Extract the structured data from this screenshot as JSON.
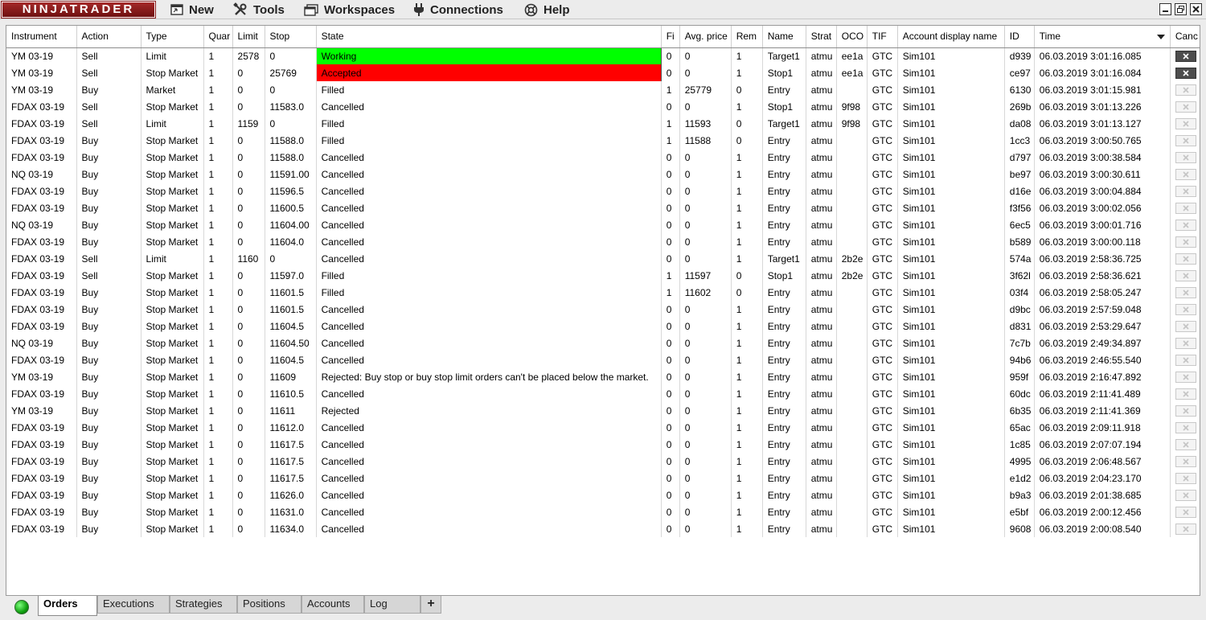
{
  "app": {
    "logo_text": "NINJATRADER"
  },
  "menu": [
    {
      "label": "New",
      "icon": "new-window-icon"
    },
    {
      "label": "Tools",
      "icon": "tools-icon"
    },
    {
      "label": "Workspaces",
      "icon": "workspaces-icon"
    },
    {
      "label": "Connections",
      "icon": "plug-icon"
    },
    {
      "label": "Help",
      "icon": "help-icon"
    }
  ],
  "window_controls": [
    "minimize-icon",
    "restore-icon",
    "close-icon"
  ],
  "colors": {
    "working": "#00ff00",
    "accepted": "#ff0000",
    "brand": "#8a1c1c"
  },
  "table": {
    "columns": [
      "Instrument",
      "Action",
      "Type",
      "Quar",
      "Limit",
      "Stop",
      "State",
      "Fi",
      "Avg. price",
      "Rem",
      "Name",
      "Strat",
      "OCO",
      "TIF",
      "Account display name",
      "ID",
      "Time",
      "Canc"
    ],
    "sorted_column": "Time",
    "rows": [
      {
        "instrument": "YM 03-19",
        "action": "Sell",
        "type": "Limit",
        "quantity": "1",
        "limit": "2578",
        "stop": "0",
        "state": "Working",
        "filled": "0",
        "avg_price": "0",
        "remaining": "1",
        "name": "Target1",
        "strategy": "atmu",
        "oco": "ee1a",
        "tif": "GTC",
        "account": "Sim101",
        "id": "d939",
        "time": "06.03.2019 3:01:16.085",
        "cancel_enabled": true
      },
      {
        "instrument": "YM 03-19",
        "action": "Sell",
        "type": "Stop Market",
        "quantity": "1",
        "limit": "0",
        "stop": "25769",
        "state": "Accepted",
        "filled": "0",
        "avg_price": "0",
        "remaining": "1",
        "name": "Stop1",
        "strategy": "atmu",
        "oco": "ee1a",
        "tif": "GTC",
        "account": "Sim101",
        "id": "ce97",
        "time": "06.03.2019 3:01:16.084",
        "cancel_enabled": true
      },
      {
        "instrument": "YM 03-19",
        "action": "Buy",
        "type": "Market",
        "quantity": "1",
        "limit": "0",
        "stop": "0",
        "state": "Filled",
        "filled": "1",
        "avg_price": "25779",
        "remaining": "0",
        "name": "Entry",
        "strategy": "atmu",
        "oco": "",
        "tif": "GTC",
        "account": "Sim101",
        "id": "6130",
        "time": "06.03.2019 3:01:15.981",
        "cancel_enabled": false
      },
      {
        "instrument": "FDAX 03-19",
        "action": "Sell",
        "type": "Stop Market",
        "quantity": "1",
        "limit": "0",
        "stop": "11583.0",
        "state": "Cancelled",
        "filled": "0",
        "avg_price": "0",
        "remaining": "1",
        "name": "Stop1",
        "strategy": "atmu",
        "oco": "9f98",
        "tif": "GTC",
        "account": "Sim101",
        "id": "269b",
        "time": "06.03.2019 3:01:13.226",
        "cancel_enabled": false
      },
      {
        "instrument": "FDAX 03-19",
        "action": "Sell",
        "type": "Limit",
        "quantity": "1",
        "limit": "1159",
        "stop": "0",
        "state": "Filled",
        "filled": "1",
        "avg_price": "11593",
        "remaining": "0",
        "name": "Target1",
        "strategy": "atmu",
        "oco": "9f98",
        "tif": "GTC",
        "account": "Sim101",
        "id": "da08",
        "time": "06.03.2019 3:01:13.127",
        "cancel_enabled": false
      },
      {
        "instrument": "FDAX 03-19",
        "action": "Buy",
        "type": "Stop Market",
        "quantity": "1",
        "limit": "0",
        "stop": "11588.0",
        "state": "Filled",
        "filled": "1",
        "avg_price": "11588",
        "remaining": "0",
        "name": "Entry",
        "strategy": "atmu",
        "oco": "",
        "tif": "GTC",
        "account": "Sim101",
        "id": "1cc3",
        "time": "06.03.2019 3:00:50.765",
        "cancel_enabled": false
      },
      {
        "instrument": "FDAX 03-19",
        "action": "Buy",
        "type": "Stop Market",
        "quantity": "1",
        "limit": "0",
        "stop": "11588.0",
        "state": "Cancelled",
        "filled": "0",
        "avg_price": "0",
        "remaining": "1",
        "name": "Entry",
        "strategy": "atmu",
        "oco": "",
        "tif": "GTC",
        "account": "Sim101",
        "id": "d797",
        "time": "06.03.2019 3:00:38.584",
        "cancel_enabled": false
      },
      {
        "instrument": "NQ 03-19",
        "action": "Buy",
        "type": "Stop Market",
        "quantity": "1",
        "limit": "0",
        "stop": "11591.00",
        "state": "Cancelled",
        "filled": "0",
        "avg_price": "0",
        "remaining": "1",
        "name": "Entry",
        "strategy": "atmu",
        "oco": "",
        "tif": "GTC",
        "account": "Sim101",
        "id": "be97",
        "time": "06.03.2019 3:00:30.611",
        "cancel_enabled": false
      },
      {
        "instrument": "FDAX 03-19",
        "action": "Buy",
        "type": "Stop Market",
        "quantity": "1",
        "limit": "0",
        "stop": "11596.5",
        "state": "Cancelled",
        "filled": "0",
        "avg_price": "0",
        "remaining": "1",
        "name": "Entry",
        "strategy": "atmu",
        "oco": "",
        "tif": "GTC",
        "account": "Sim101",
        "id": "d16e",
        "time": "06.03.2019 3:00:04.884",
        "cancel_enabled": false
      },
      {
        "instrument": "FDAX 03-19",
        "action": "Buy",
        "type": "Stop Market",
        "quantity": "1",
        "limit": "0",
        "stop": "11600.5",
        "state": "Cancelled",
        "filled": "0",
        "avg_price": "0",
        "remaining": "1",
        "name": "Entry",
        "strategy": "atmu",
        "oco": "",
        "tif": "GTC",
        "account": "Sim101",
        "id": "f3f56",
        "time": "06.03.2019 3:00:02.056",
        "cancel_enabled": false
      },
      {
        "instrument": "NQ 03-19",
        "action": "Buy",
        "type": "Stop Market",
        "quantity": "1",
        "limit": "0",
        "stop": "11604.00",
        "state": "Cancelled",
        "filled": "0",
        "avg_price": "0",
        "remaining": "1",
        "name": "Entry",
        "strategy": "atmu",
        "oco": "",
        "tif": "GTC",
        "account": "Sim101",
        "id": "6ec5",
        "time": "06.03.2019 3:00:01.716",
        "cancel_enabled": false
      },
      {
        "instrument": "FDAX 03-19",
        "action": "Buy",
        "type": "Stop Market",
        "quantity": "1",
        "limit": "0",
        "stop": "11604.0",
        "state": "Cancelled",
        "filled": "0",
        "avg_price": "0",
        "remaining": "1",
        "name": "Entry",
        "strategy": "atmu",
        "oco": "",
        "tif": "GTC",
        "account": "Sim101",
        "id": "b589",
        "time": "06.03.2019 3:00:00.118",
        "cancel_enabled": false
      },
      {
        "instrument": "FDAX 03-19",
        "action": "Sell",
        "type": "Limit",
        "quantity": "1",
        "limit": "1160",
        "stop": "0",
        "state": "Cancelled",
        "filled": "0",
        "avg_price": "0",
        "remaining": "1",
        "name": "Target1",
        "strategy": "atmu",
        "oco": "2b2e",
        "tif": "GTC",
        "account": "Sim101",
        "id": "574a",
        "time": "06.03.2019 2:58:36.725",
        "cancel_enabled": false
      },
      {
        "instrument": "FDAX 03-19",
        "action": "Sell",
        "type": "Stop Market",
        "quantity": "1",
        "limit": "0",
        "stop": "11597.0",
        "state": "Filled",
        "filled": "1",
        "avg_price": "11597",
        "remaining": "0",
        "name": "Stop1",
        "strategy": "atmu",
        "oco": "2b2e",
        "tif": "GTC",
        "account": "Sim101",
        "id": "3f62l",
        "time": "06.03.2019 2:58:36.621",
        "cancel_enabled": false
      },
      {
        "instrument": "FDAX 03-19",
        "action": "Buy",
        "type": "Stop Market",
        "quantity": "1",
        "limit": "0",
        "stop": "11601.5",
        "state": "Filled",
        "filled": "1",
        "avg_price": "11602",
        "remaining": "0",
        "name": "Entry",
        "strategy": "atmu",
        "oco": "",
        "tif": "GTC",
        "account": "Sim101",
        "id": "03f4",
        "time": "06.03.2019 2:58:05.247",
        "cancel_enabled": false
      },
      {
        "instrument": "FDAX 03-19",
        "action": "Buy",
        "type": "Stop Market",
        "quantity": "1",
        "limit": "0",
        "stop": "11601.5",
        "state": "Cancelled",
        "filled": "0",
        "avg_price": "0",
        "remaining": "1",
        "name": "Entry",
        "strategy": "atmu",
        "oco": "",
        "tif": "GTC",
        "account": "Sim101",
        "id": "d9bc",
        "time": "06.03.2019 2:57:59.048",
        "cancel_enabled": false
      },
      {
        "instrument": "FDAX 03-19",
        "action": "Buy",
        "type": "Stop Market",
        "quantity": "1",
        "limit": "0",
        "stop": "11604.5",
        "state": "Cancelled",
        "filled": "0",
        "avg_price": "0",
        "remaining": "1",
        "name": "Entry",
        "strategy": "atmu",
        "oco": "",
        "tif": "GTC",
        "account": "Sim101",
        "id": "d831",
        "time": "06.03.2019 2:53:29.647",
        "cancel_enabled": false
      },
      {
        "instrument": "NQ 03-19",
        "action": "Buy",
        "type": "Stop Market",
        "quantity": "1",
        "limit": "0",
        "stop": "11604.50",
        "state": "Cancelled",
        "filled": "0",
        "avg_price": "0",
        "remaining": "1",
        "name": "Entry",
        "strategy": "atmu",
        "oco": "",
        "tif": "GTC",
        "account": "Sim101",
        "id": "7c7b",
        "time": "06.03.2019 2:49:34.897",
        "cancel_enabled": false
      },
      {
        "instrument": "FDAX 03-19",
        "action": "Buy",
        "type": "Stop Market",
        "quantity": "1",
        "limit": "0",
        "stop": "11604.5",
        "state": "Cancelled",
        "filled": "0",
        "avg_price": "0",
        "remaining": "1",
        "name": "Entry",
        "strategy": "atmu",
        "oco": "",
        "tif": "GTC",
        "account": "Sim101",
        "id": "94b6",
        "time": "06.03.2019 2:46:55.540",
        "cancel_enabled": false
      },
      {
        "instrument": "YM 03-19",
        "action": "Buy",
        "type": "Stop Market",
        "quantity": "1",
        "limit": "0",
        "stop": "11609",
        "state": "Rejected: Buy stop or buy stop limit orders can't be placed below the market.",
        "filled": "0",
        "avg_price": "0",
        "remaining": "1",
        "name": "Entry",
        "strategy": "atmu",
        "oco": "",
        "tif": "GTC",
        "account": "Sim101",
        "id": "959f",
        "time": "06.03.2019 2:16:47.892",
        "cancel_enabled": false
      },
      {
        "instrument": "FDAX 03-19",
        "action": "Buy",
        "type": "Stop Market",
        "quantity": "1",
        "limit": "0",
        "stop": "11610.5",
        "state": "Cancelled",
        "filled": "0",
        "avg_price": "0",
        "remaining": "1",
        "name": "Entry",
        "strategy": "atmu",
        "oco": "",
        "tif": "GTC",
        "account": "Sim101",
        "id": "60dc",
        "time": "06.03.2019 2:11:41.489",
        "cancel_enabled": false
      },
      {
        "instrument": "YM 03-19",
        "action": "Buy",
        "type": "Stop Market",
        "quantity": "1",
        "limit": "0",
        "stop": "11611",
        "state": "Rejected",
        "filled": "0",
        "avg_price": "0",
        "remaining": "1",
        "name": "Entry",
        "strategy": "atmu",
        "oco": "",
        "tif": "GTC",
        "account": "Sim101",
        "id": "6b35",
        "time": "06.03.2019 2:11:41.369",
        "cancel_enabled": false
      },
      {
        "instrument": "FDAX 03-19",
        "action": "Buy",
        "type": "Stop Market",
        "quantity": "1",
        "limit": "0",
        "stop": "11612.0",
        "state": "Cancelled",
        "filled": "0",
        "avg_price": "0",
        "remaining": "1",
        "name": "Entry",
        "strategy": "atmu",
        "oco": "",
        "tif": "GTC",
        "account": "Sim101",
        "id": "65ac",
        "time": "06.03.2019 2:09:11.918",
        "cancel_enabled": false
      },
      {
        "instrument": "FDAX 03-19",
        "action": "Buy",
        "type": "Stop Market",
        "quantity": "1",
        "limit": "0",
        "stop": "11617.5",
        "state": "Cancelled",
        "filled": "0",
        "avg_price": "0",
        "remaining": "1",
        "name": "Entry",
        "strategy": "atmu",
        "oco": "",
        "tif": "GTC",
        "account": "Sim101",
        "id": "1c85",
        "time": "06.03.2019 2:07:07.194",
        "cancel_enabled": false
      },
      {
        "instrument": "FDAX 03-19",
        "action": "Buy",
        "type": "Stop Market",
        "quantity": "1",
        "limit": "0",
        "stop": "11617.5",
        "state": "Cancelled",
        "filled": "0",
        "avg_price": "0",
        "remaining": "1",
        "name": "Entry",
        "strategy": "atmu",
        "oco": "",
        "tif": "GTC",
        "account": "Sim101",
        "id": "4995",
        "time": "06.03.2019 2:06:48.567",
        "cancel_enabled": false
      },
      {
        "instrument": "FDAX 03-19",
        "action": "Buy",
        "type": "Stop Market",
        "quantity": "1",
        "limit": "0",
        "stop": "11617.5",
        "state": "Cancelled",
        "filled": "0",
        "avg_price": "0",
        "remaining": "1",
        "name": "Entry",
        "strategy": "atmu",
        "oco": "",
        "tif": "GTC",
        "account": "Sim101",
        "id": "e1d2",
        "time": "06.03.2019 2:04:23.170",
        "cancel_enabled": false
      },
      {
        "instrument": "FDAX 03-19",
        "action": "Buy",
        "type": "Stop Market",
        "quantity": "1",
        "limit": "0",
        "stop": "11626.0",
        "state": "Cancelled",
        "filled": "0",
        "avg_price": "0",
        "remaining": "1",
        "name": "Entry",
        "strategy": "atmu",
        "oco": "",
        "tif": "GTC",
        "account": "Sim101",
        "id": "b9a3",
        "time": "06.03.2019 2:01:38.685",
        "cancel_enabled": false
      },
      {
        "instrument": "FDAX 03-19",
        "action": "Buy",
        "type": "Stop Market",
        "quantity": "1",
        "limit": "0",
        "stop": "11631.0",
        "state": "Cancelled",
        "filled": "0",
        "avg_price": "0",
        "remaining": "1",
        "name": "Entry",
        "strategy": "atmu",
        "oco": "",
        "tif": "GTC",
        "account": "Sim101",
        "id": "e5bf",
        "time": "06.03.2019 2:00:12.456",
        "cancel_enabled": false
      },
      {
        "instrument": "FDAX 03-19",
        "action": "Buy",
        "type": "Stop Market",
        "quantity": "1",
        "limit": "0",
        "stop": "11634.0",
        "state": "Cancelled",
        "filled": "0",
        "avg_price": "0",
        "remaining": "1",
        "name": "Entry",
        "strategy": "atmu",
        "oco": "",
        "tif": "GTC",
        "account": "Sim101",
        "id": "9608",
        "time": "06.03.2019 2:00:08.540",
        "cancel_enabled": false
      }
    ]
  },
  "tabs": [
    {
      "label": "Orders",
      "active": true
    },
    {
      "label": "Executions",
      "active": false
    },
    {
      "label": "Strategies",
      "active": false
    },
    {
      "label": "Positions",
      "active": false
    },
    {
      "label": "Accounts",
      "active": false
    },
    {
      "label": "Log",
      "active": false
    }
  ],
  "add_tab_label": "+",
  "connection_status": "connected"
}
